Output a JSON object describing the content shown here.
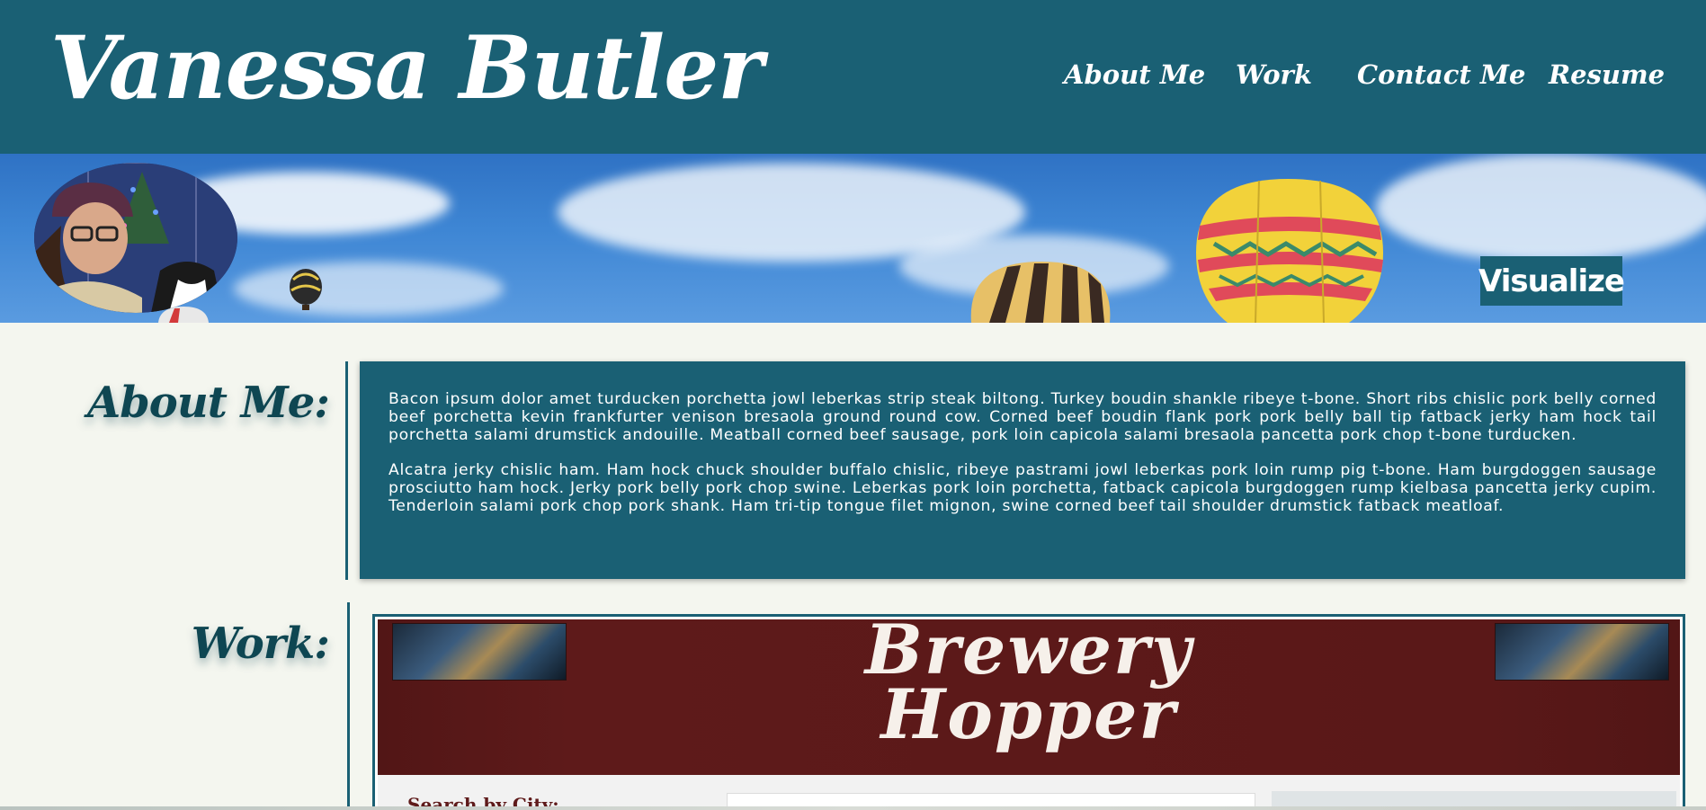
{
  "header": {
    "title": "Vanessa Butler",
    "nav": [
      "About Me",
      "Work",
      "Contact Me",
      "Resume"
    ]
  },
  "banner": {
    "cta_label": "Visualize"
  },
  "about": {
    "heading": "About Me:",
    "paragraphs": [
      "Bacon ipsum dolor amet turducken porchetta jowl leberkas strip steak biltong. Turkey boudin shankle ribeye t-bone. Short ribs chislic pork belly corned beef porchetta kevin frankfurter venison bresaola ground round cow. Corned beef boudin flank pork pork belly ball tip fatback jerky ham hock tail porchetta salami drumstick andouille. Meatball corned beef sausage, pork loin capicola salami bresaola pancetta pork chop t-bone turducken.",
      "Alcatra jerky chislic ham. Ham hock chuck shoulder buffalo chislic, ribeye pastrami jowl leberkas pork loin rump pig t-bone. Ham burgdoggen sausage prosciutto ham hock. Jerky pork belly pork chop swine. Leberkas pork loin porchetta, fatback capicola burgdoggen rump kielbasa pancetta jerky cupim. Tenderloin salami pork chop pork shank. Ham tri-tip tongue filet mignon, swine corned beef tail shoulder drumstick fatback meatloaf."
    ]
  },
  "work": {
    "heading": "Work:",
    "project": {
      "title_line1": "Brewery",
      "title_line2": "Hopper",
      "search_label": "Search by City:"
    }
  },
  "colors": {
    "primary": "#1a6074",
    "heading_text": "#0e4652",
    "page_background": "#f4f6ef",
    "brewery_red": "#5e1a1a"
  }
}
